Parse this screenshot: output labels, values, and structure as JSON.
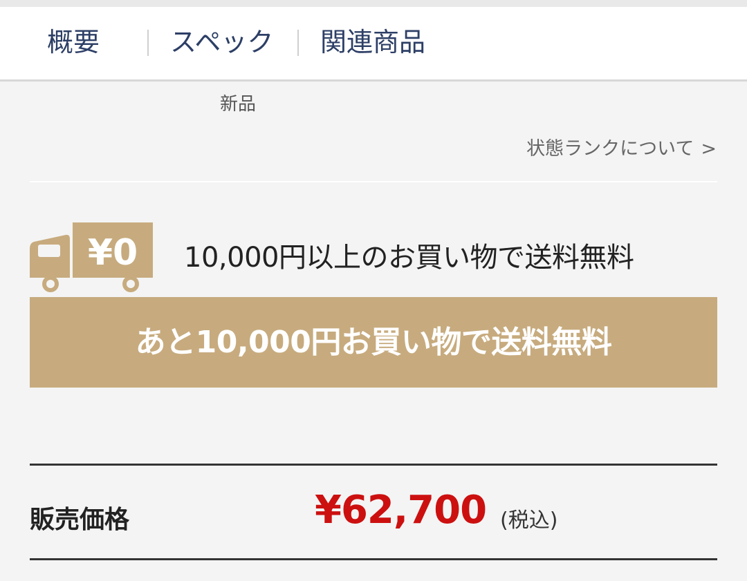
{
  "tabs": [
    {
      "label": "概要"
    },
    {
      "label": "スペック"
    },
    {
      "label": "関連商品"
    }
  ],
  "condition": {
    "value": "新品",
    "rank_link": "状態ランクについて",
    "rank_link_chevron": ">"
  },
  "shipping": {
    "icon_label": "¥0",
    "note": "10,000円以上のお買い物で送料無料",
    "banner": "あと10,000円お買い物で送料無料"
  },
  "price": {
    "label": "販売価格",
    "value": "¥62,700",
    "tax_note": "(税込)"
  },
  "colors": {
    "accent_gold": "#c7ab7e",
    "tab_text": "#2d3f66",
    "price_red": "#cc1010"
  },
  "icons": {
    "truck": "truck-icon",
    "chevron": "chevron-right-icon"
  }
}
